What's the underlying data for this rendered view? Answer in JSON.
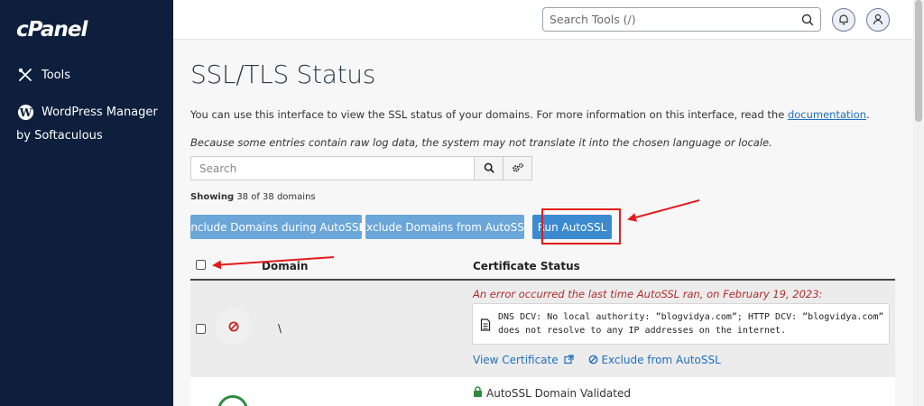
{
  "sidebar": {
    "logo": "cPanel",
    "items": [
      {
        "label": "Tools",
        "icon": "tools-icon"
      },
      {
        "label": "WordPress Manager",
        "label2": "by Softaculous",
        "icon": "wordpress-icon"
      }
    ]
  },
  "header": {
    "search_placeholder": "Search Tools (/)"
  },
  "main": {
    "title": "SSL/TLS Status",
    "description": "You can use this interface to view the SSL status of your domains. For more information on this interface, read the ",
    "description_link": "documentation",
    "description_end": ".",
    "note": "Because some entries contain raw log data, the system may not translate it into the chosen language or locale.",
    "search_placeholder": "Search",
    "showing_label": "Showing",
    "showing_text": "38 of 38 domains",
    "buttons": {
      "include": "Include Domains during AutoSSL",
      "exclude": "Exclude Domains from AutoSSL",
      "run": "Run AutoSSL"
    },
    "table": {
      "columns": [
        "Domain",
        "Certificate Status"
      ],
      "rows": [
        {
          "domain": "\\",
          "error": "An error occurred the last time AutoSSL ran, on February 19, 2023:",
          "log": "DNS DCV: No local authority: ”blogvidya.com”; HTTP DCV: ”blogvidya.com” does not resolve to any IP addresses on the internet.",
          "view_certificate": "View Certificate",
          "exclude": "Exclude from AutoSSL"
        },
        {
          "status": "AutoSSL Domain Validated"
        }
      ]
    }
  },
  "colors": {
    "sidebar_bg": "#0d1f3c",
    "primary_button": "#3c8ad0",
    "disabled_button": "#6ba6d9",
    "error_text": "#b32c2c",
    "highlight": "#e41b1b",
    "success": "#2e8b3e"
  }
}
